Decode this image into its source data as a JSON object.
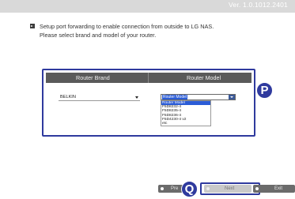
{
  "header": {
    "version": "Ver. 1.0.1012.2401"
  },
  "intro": {
    "line1": "Setup port forwarding to enable connection from outside to LG NAS.",
    "line2": "Please select brand and model of your router."
  },
  "table": {
    "brand_header": "Router Brand",
    "model_header": "Router Model",
    "brand_value": "BELKIN",
    "model_value": "Router Model",
    "model_options": [
      "Router Model",
      "F5D8232-4",
      "F5D8235-4",
      "F5D8236-4",
      "F5D4230-4 v2",
      "etc"
    ],
    "selected_option": "Router Model"
  },
  "annotations": {
    "panel_marker": "P",
    "button_marker": "Q"
  },
  "buttons": {
    "prev": "Pre",
    "next": "Next",
    "exit": "Exit"
  },
  "colors": {
    "accent": "#2f3a9e",
    "header_bg": "#5a5a5a",
    "selection": "#2b5cd6"
  }
}
